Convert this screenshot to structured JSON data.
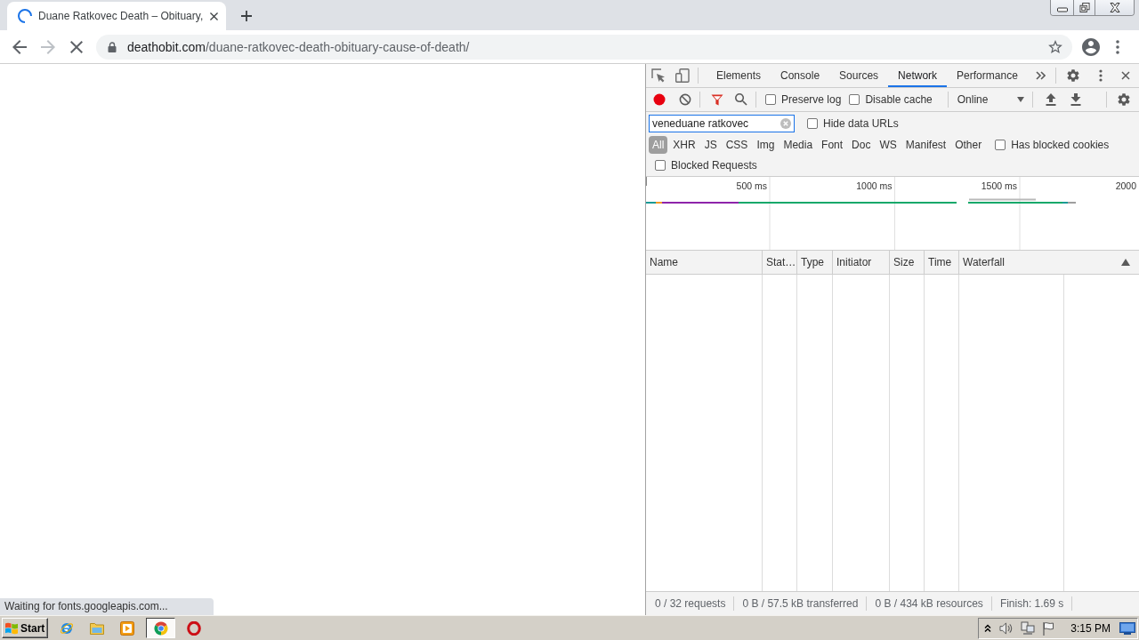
{
  "browser": {
    "tabs": [
      {
        "title": "Duane Ratkovec Death – Obituary,",
        "selected": true,
        "loading": true
      }
    ]
  },
  "toolbar": {
    "back_disabled": false,
    "forward_disabled": true,
    "loading": true,
    "url": {
      "host": "deathobit.com",
      "path": "/duane-ratkovec-death-obituary-cause-of-death/"
    },
    "bookmarked": false
  },
  "page": {
    "status_bubble": "Waiting for fonts.googleapis.com..."
  },
  "devtools": {
    "panel_tabs": [
      {
        "label": "Elements",
        "selected": false
      },
      {
        "label": "Console",
        "selected": false
      },
      {
        "label": "Sources",
        "selected": false
      },
      {
        "label": "Network",
        "selected": true
      },
      {
        "label": "Performance",
        "selected": false
      }
    ],
    "network": {
      "recording": true,
      "filter_enabled": true,
      "options": [
        {
          "label": "Preserve log",
          "checked": false
        },
        {
          "label": "Disable cache",
          "checked": false
        }
      ],
      "throttling": "Online",
      "filter": {
        "value": "veneduane ratkovec",
        "focused": true
      },
      "hide_data_urls": {
        "label": "Hide data URLs",
        "checked": false
      },
      "type_filters": [
        {
          "label": "All",
          "selected": true
        },
        {
          "label": "XHR",
          "selected": false
        },
        {
          "label": "JS",
          "selected": false
        },
        {
          "label": "CSS",
          "selected": false
        },
        {
          "label": "Img",
          "selected": false
        },
        {
          "label": "Media",
          "selected": false
        },
        {
          "label": "Font",
          "selected": false
        },
        {
          "label": "Doc",
          "selected": false
        },
        {
          "label": "WS",
          "selected": false
        },
        {
          "label": "Manifest",
          "selected": false
        },
        {
          "label": "Other",
          "selected": false
        }
      ],
      "has_blocked_cookies": {
        "label": "Has blocked cookies",
        "checked": false
      },
      "blocked_requests": {
        "label": "Blocked Requests",
        "checked": false
      },
      "overview": {
        "ticks": [
          "500 ms",
          "1000 ms",
          "1500 ms",
          "2000"
        ]
      },
      "table": {
        "columns": [
          "Name",
          "Stat…",
          "Type",
          "Initiator",
          "Size",
          "Time",
          "Waterfall"
        ]
      },
      "summary": [
        "0 / 32 requests",
        "0 B / 57.5 kB transferred",
        "0 B / 434 kB resources",
        "Finish: 1.69 s"
      ]
    }
  },
  "taskbar": {
    "start": "Start",
    "items": [
      {
        "kind": "ie",
        "selected": false
      },
      {
        "kind": "folder",
        "selected": false
      },
      {
        "kind": "media",
        "selected": false
      },
      {
        "kind": "chrome",
        "selected": true
      },
      {
        "kind": "opera",
        "selected": false
      }
    ],
    "clock": "3:15 PM"
  }
}
